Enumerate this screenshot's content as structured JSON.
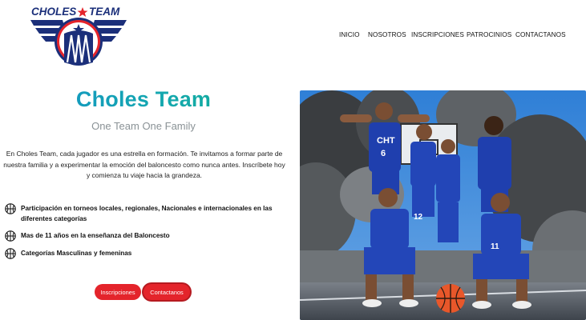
{
  "logo": {
    "wordmark": "CHOLES",
    "wordmark2": "TEAM",
    "icon": "basketball-star-wings-logo"
  },
  "nav": {
    "items": [
      "INICIO",
      "NOSOTROS",
      "INSCRIPCIONES",
      "PATROCINIOS",
      "CONTACTANOS"
    ]
  },
  "hero": {
    "title": "Choles Team",
    "subtitle": "One Team One Family",
    "description": "En Choles Team, cada jugador es una estrella en formación. Te invitamos a formar parte de nuestra familia y a experimentar la emoción del baloncesto como nunca antes. Inscríbete hoy y comienza tu viaje hacia la grandeza.",
    "features": [
      "Participación en torneos locales, regionales, Nacionales e internacionales en las diferentes categorías",
      "Mas de 11 años en la enseñanza del Baloncesto",
      "Categorías Masculinas y femeninas"
    ],
    "feature_icon": "basketball-icon",
    "buttons": {
      "primary": "Inscripciones",
      "secondary": "Contactanos"
    }
  },
  "photo": {
    "jersey_text": "CHT",
    "numbers": [
      "6",
      "12",
      "11"
    ]
  },
  "colors": {
    "brand_navy": "#1b2f7a",
    "brand_red": "#e4242b",
    "title_gradient_start": "#1591c8",
    "title_gradient_end": "#12b08e",
    "subtitle": "#8a9296"
  }
}
